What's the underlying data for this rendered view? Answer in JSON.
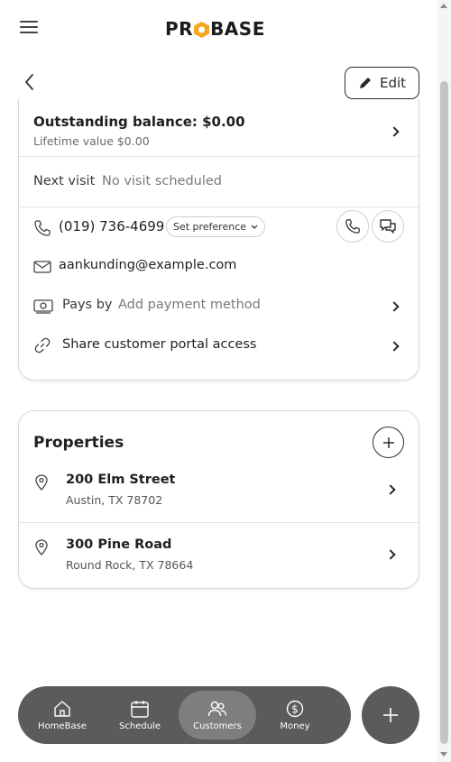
{
  "header": {
    "logo_text_pre": "PR",
    "logo_text_post": "BASE",
    "menu_icon": "hamburger-icon"
  },
  "subheader": {
    "back_icon": "chevron-left-icon",
    "edit_label": "Edit"
  },
  "customer": {
    "balance_title": "Outstanding balance: $0.00",
    "lifetime_value": "Lifetime value $0.00",
    "next_visit_label": "Next visit",
    "next_visit_value": "No visit scheduled",
    "phone": "(019) 736-4699",
    "set_preference": "Set preference",
    "email": "aankunding@example.com",
    "pays_by_label": "Pays by",
    "pays_by_value": "Add payment method",
    "share_portal": "Share customer portal access"
  },
  "properties": {
    "title": "Properties",
    "items": [
      {
        "name": "200 Elm Street",
        "address": "Austin, TX 78702"
      },
      {
        "name": "300 Pine Road",
        "address": "Round Rock, TX 78664"
      }
    ]
  },
  "bottom_nav": {
    "items": [
      {
        "label": "HomeBase",
        "icon": "home-icon"
      },
      {
        "label": "Schedule",
        "icon": "calendar-icon"
      },
      {
        "label": "Customers",
        "icon": "users-icon",
        "active": true
      },
      {
        "label": "Money",
        "icon": "dollar-icon"
      }
    ],
    "fab_icon": "plus-icon"
  },
  "colors": {
    "accent_logo": "#f5a623",
    "nav_bg": "#5b5b5b",
    "nav_active": "#7e7e7e"
  }
}
